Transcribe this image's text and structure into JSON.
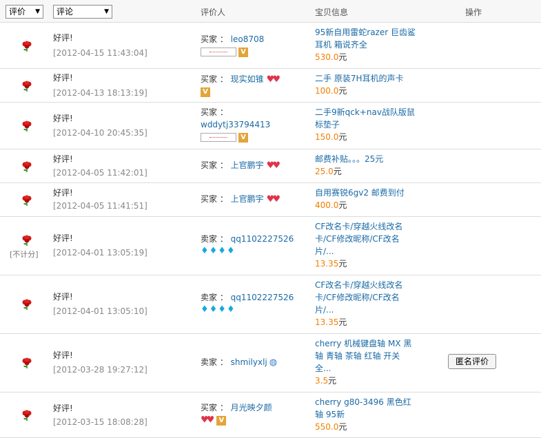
{
  "header": {
    "filter_rating": "评价",
    "filter_comment": "评论",
    "col_reviewer": "评价人",
    "col_item": "宝贝信息",
    "col_action": "操作"
  },
  "rows": [
    {
      "verdict": "好评!",
      "time": "[2012-04-15 11:43:04]",
      "role": "买家 ：",
      "name": "leo8708",
      "item_title": "95新自用雷蛇razer 巨齿鲨耳机 箱说齐全",
      "price": "530.0",
      "unit": "元"
    },
    {
      "verdict": "好评!",
      "time": "[2012-04-13 18:13:19]",
      "role": "买家 ：",
      "name": "现实如锥",
      "item_title": "二手 原装7H耳机的声卡",
      "price": "100.0",
      "unit": "元"
    },
    {
      "verdict": "好评!",
      "time": "[2012-04-10 20:45:35]",
      "role": "买家 ：",
      "name": "wddytj33794413",
      "item_title": "二手9新qck+nav战队版鼠标垫子",
      "price": "150.0",
      "unit": "元"
    },
    {
      "verdict": "好评!",
      "time": "[2012-04-05 11:42:01]",
      "role": "买家 ：",
      "name": "上官鹏宇",
      "item_title": "邮费补贴。。。25元",
      "price": "25.0",
      "unit": "元"
    },
    {
      "verdict": "好评!",
      "time": "[2012-04-05 11:41:51]",
      "role": "买家 ：",
      "name": "上官鹏宇",
      "item_title": "自用赛锐6gv2 邮费到付",
      "price": "400.0",
      "unit": "元"
    },
    {
      "verdict": "好评!",
      "time": "[2012-04-01 13:05:19]",
      "noscore": "[不计分]",
      "role": "卖家 ：",
      "name": "qq1102227526",
      "item_title": "CF改名卡/穿越火线改名卡/CF修改昵称/CF改名片/...",
      "price": "13.35",
      "unit": "元"
    },
    {
      "verdict": "好评!",
      "time": "[2012-04-01 13:05:10]",
      "role": "卖家 ：",
      "name": "qq1102227526",
      "item_title": "CF改名卡/穿越火线改名卡/CF修改昵称/CF改名片/...",
      "price": "13.35",
      "unit": "元"
    },
    {
      "verdict": "好评!",
      "time": "[2012-03-28 19:27:12]",
      "role": "卖家 ：",
      "name": "shmilyxlj",
      "item_title": "cherry 机械键盘轴 MX 黑轴 青轴 茶轴 红轴 开关 全...",
      "price": "3.5",
      "unit": "元",
      "action": "匿名评价"
    },
    {
      "verdict": "好评!",
      "time": "[2012-03-15 18:08:28]",
      "role": "买家 ：",
      "name": "月光映夕颜",
      "item_title": "cherry g80-3496 黑色红轴 95新",
      "price": "550.0",
      "unit": "元"
    }
  ],
  "icons": {
    "rose": "rose-icon",
    "verified": "verified-v-icon",
    "heart": "heart-rank-icon",
    "diamond": "diamond-rank-icon",
    "globe": "globe-badge-icon"
  },
  "colors": {
    "link": "#1a6aa5",
    "price": "#f27e00",
    "muted": "#888888",
    "divider": "#dcdcdc"
  }
}
